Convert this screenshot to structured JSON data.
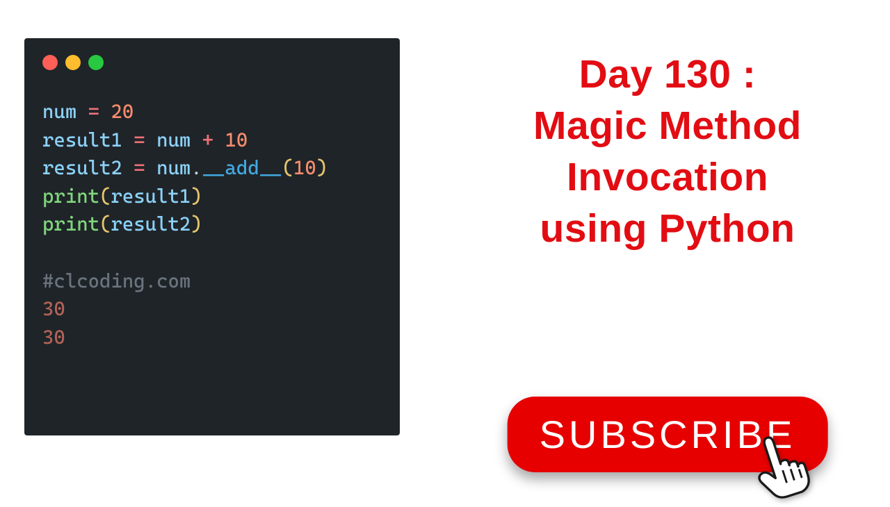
{
  "title": {
    "line1": "Day 130 :",
    "line2": "Magic Method",
    "line3": "Invocation",
    "line4": "using Python"
  },
  "subscribe": {
    "label": "SUBSCRIBE"
  },
  "code": {
    "line1": {
      "var": "num",
      "eq": " = ",
      "val": "20"
    },
    "line2": {
      "var": "result1",
      "eq": " = ",
      "var2": "num",
      "plus": " + ",
      "val": "10"
    },
    "line3": {
      "var": "result2",
      "eq": " = ",
      "var2": "num",
      "dot": ".",
      "method": "__add__",
      "lp": "(",
      "arg": "10",
      "rp": ")"
    },
    "line4": {
      "fn": "print",
      "lp": "(",
      "arg": "result1",
      "rp": ")"
    },
    "line5": {
      "fn": "print",
      "lp": "(",
      "arg": "result2",
      "rp": ")"
    },
    "comment": "#clcoding.com",
    "output1": "30",
    "output2": "30"
  }
}
